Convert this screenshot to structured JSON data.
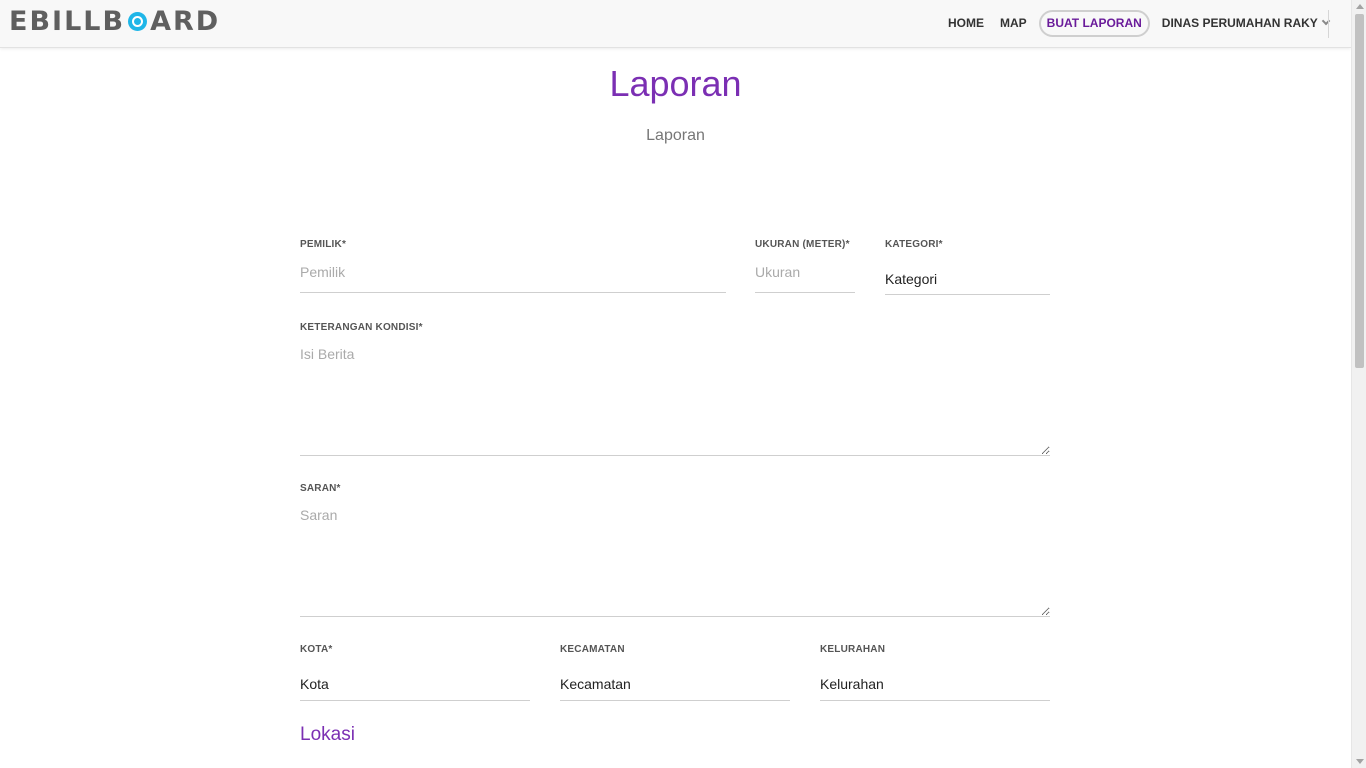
{
  "brand": {
    "left": "EBILLB",
    "right": "ARD"
  },
  "nav": {
    "items": [
      "HOME",
      "MAP",
      "BUAT LAPORAN",
      "DINAS PERUMAHAN RAKY"
    ],
    "active_index": 2
  },
  "header": {
    "title": "Laporan",
    "subtitle": "Laporan"
  },
  "form": {
    "pemilik": {
      "label": "PEMILIK*",
      "placeholder": "Pemilik",
      "value": ""
    },
    "ukuran": {
      "label": "UKURAN (METER)*",
      "placeholder": "Ukuran",
      "value": ""
    },
    "kategori": {
      "label": "KATEGORI*",
      "selected": "Kategori"
    },
    "keterangan": {
      "label": "KETERANGAN KONDISI*",
      "placeholder": "Isi Berita",
      "value": ""
    },
    "saran": {
      "label": "SARAN*",
      "placeholder": "Saran",
      "value": ""
    },
    "kota": {
      "label": "KOTA*",
      "selected": "Kota"
    },
    "kecamatan": {
      "label": "KECAMATAN",
      "selected": "Kecamatan"
    },
    "kelurahan": {
      "label": "KELURAHAN",
      "selected": "Kelurahan"
    }
  },
  "sections": {
    "lokasi": "Lokasi"
  },
  "colors": {
    "accent": "#7b2fb3",
    "brand_icon": "#1fb6e8",
    "navbar_bg": "#f8f8f8"
  },
  "icons": {
    "brand_o": "circle-logo-icon",
    "dropdown": "chevron-down-icon"
  }
}
